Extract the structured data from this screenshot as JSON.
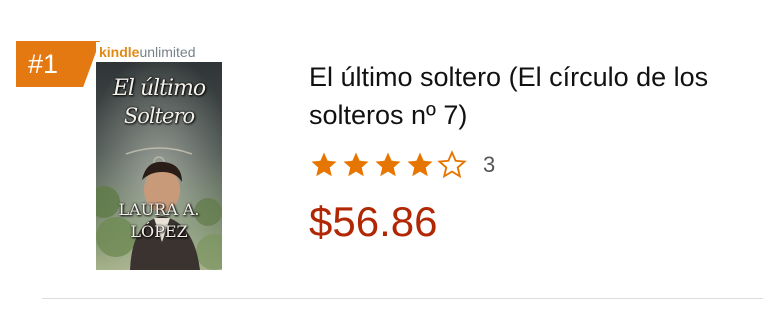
{
  "rank_badge": {
    "label": "#1",
    "color": "#e47911"
  },
  "cover": {
    "banner_kindle": "kindle",
    "banner_unlimited": "unlimited",
    "title_line_1": "El último",
    "title_line_2": "Soltero",
    "author_line_1": "LAURA A.",
    "author_line_2": "LÓPEZ"
  },
  "book": {
    "title": "El último soltero (El círculo de los solteros nº 7)",
    "rating": {
      "value": 4,
      "max": 5,
      "count": "3",
      "star_color": "#e77600"
    },
    "price": "$56.86",
    "price_color": "#b12704"
  }
}
